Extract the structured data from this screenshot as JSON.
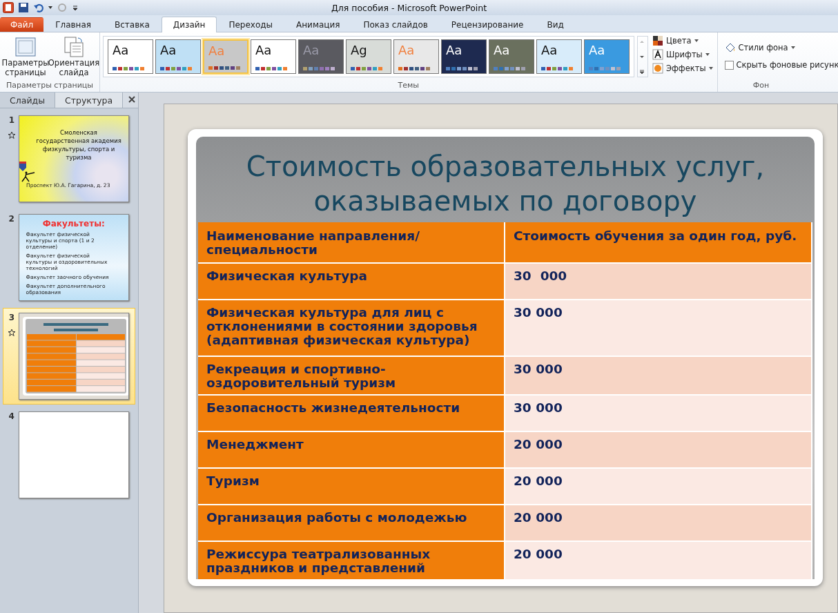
{
  "window": {
    "title": "Для пособия  -  Microsoft PowerPoint"
  },
  "ribbon_tabs": [
    {
      "label": "Файл",
      "kind": "file",
      "selected": false
    },
    {
      "label": "Главная",
      "kind": "tab",
      "selected": false
    },
    {
      "label": "Вставка",
      "kind": "tab",
      "selected": false
    },
    {
      "label": "Дизайн",
      "kind": "tab",
      "selected": true
    },
    {
      "label": "Переходы",
      "kind": "tab",
      "selected": false
    },
    {
      "label": "Анимация",
      "kind": "tab",
      "selected": false
    },
    {
      "label": "Показ слайдов",
      "kind": "tab",
      "selected": false
    },
    {
      "label": "Рецензирование",
      "kind": "tab",
      "selected": false
    },
    {
      "label": "Вид",
      "kind": "tab",
      "selected": false
    }
  ],
  "page_setup": {
    "buttons": [
      {
        "label": "Параметры страницы",
        "kind": "page"
      },
      {
        "label": "Ориентация слайда",
        "kind": "orientation"
      }
    ],
    "group_label": "Параметры страницы"
  },
  "themes": {
    "group_label": "Темы",
    "items": [
      {
        "label": "Aa",
        "color": "#ffffff",
        "kind": "light",
        "selected": false
      },
      {
        "label": "Aa",
        "color": "#bfe0f5",
        "kind": "light",
        "selected": false
      },
      {
        "label": "Aa",
        "color": "#c8c8c8",
        "kind": "orange",
        "selected": true
      },
      {
        "label": "Aa",
        "color": "#ffffff",
        "kind": "light",
        "selected": false
      },
      {
        "label": "Aa",
        "color": "#5a5a60",
        "kind": "grey",
        "selected": false
      },
      {
        "label": "Ag",
        "color": "#d8dcd8",
        "kind": "light",
        "selected": false
      },
      {
        "label": "Aa",
        "color": "#e8e8e8",
        "kind": "orange",
        "selected": false
      },
      {
        "label": "Aa",
        "color": "#1e2a50",
        "kind": "dark",
        "selected": false
      },
      {
        "label": "Aa",
        "color": "#6a705e",
        "kind": "dark",
        "selected": false
      },
      {
        "label": "Aa",
        "color": "#d8ecfa",
        "kind": "light",
        "selected": false
      },
      {
        "label": "Aa",
        "color": "#3a9ae0",
        "kind": "dark",
        "selected": false
      }
    ],
    "options": [
      {
        "label": "Цвета",
        "kind": "colors"
      },
      {
        "label": "Шрифты",
        "kind": "fonts"
      },
      {
        "label": "Эффекты",
        "kind": "effects"
      }
    ]
  },
  "background": {
    "group_label": "Фон",
    "styles_button": "Стили фона",
    "hide_graphics": {
      "label": "Скрыть фоновые рисунк",
      "checked": false
    }
  },
  "panel_tabs": [
    {
      "label": "Слайды",
      "selected": true
    },
    {
      "label": "Структура",
      "selected": false
    }
  ],
  "slides": [
    {
      "number": "1",
      "kind": "title",
      "selected": false,
      "has_transition": true,
      "title": "Смоленская государственная академия физкультуры, спорта и туризма",
      "subtitle": "Проспект Ю.А. Гагарина, д. 23"
    },
    {
      "number": "2",
      "kind": "list",
      "selected": false,
      "has_transition": false,
      "title": "Факультеты:",
      "bullets": [
        "Факультет  физической  культуры  и спорта  (1 и 2 отделение)",
        "Факультет  физической культуры  и оздоровительных  технологий",
        "Факультет  заочного обучения",
        "Факультет  дополнительного  образования"
      ]
    },
    {
      "number": "3",
      "kind": "table",
      "selected": true,
      "has_transition": true
    },
    {
      "number": "4",
      "kind": "blank",
      "selected": false,
      "has_transition": false
    }
  ],
  "slide": {
    "title": "Стоимость образовательных услуг, оказываемых по договору",
    "table": {
      "columns": [
        "Наименование направления/специальности",
        "Стоимость обучения за один год, руб."
      ],
      "rows": [
        [
          "Физическая культура",
          "30  000"
        ],
        [
          "Физическая культура для лиц с отклонениями в состоянии здоровья (адаптивная физическая культура)",
          "30 000"
        ],
        [
          "Рекреация и спортивно-оздоровительный туризм",
          "30 000"
        ],
        [
          "Безопасность жизнедеятельности",
          "30 000"
        ],
        [
          "Менеджмент",
          "20 000"
        ],
        [
          "Туризм",
          "20 000"
        ],
        [
          "Организация работы с молодежью",
          "20 000"
        ],
        [
          "Режиссура театрализованных праздников и представлений",
          "20 000"
        ]
      ]
    }
  }
}
